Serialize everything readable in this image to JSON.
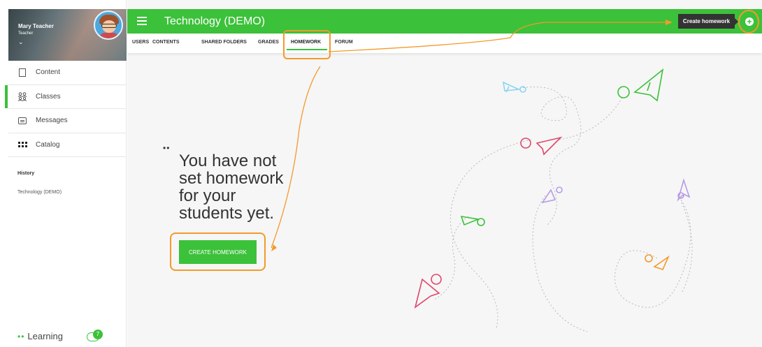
{
  "sidebar": {
    "profile": {
      "name": "Mary Teacher",
      "role": "Teacher",
      "chevron": "⌄"
    },
    "items": [
      {
        "label": "Content",
        "icon": "content-icon",
        "active": false
      },
      {
        "label": "Classes",
        "icon": "classes-icon",
        "active": true
      },
      {
        "label": "Messages",
        "icon": "messages-icon",
        "active": false
      },
      {
        "label": "Catalog",
        "icon": "catalog-icon",
        "active": false
      }
    ],
    "history_title": "History",
    "history_items": [
      "Technology (DEMO)"
    ],
    "footer": {
      "brand": "Learning",
      "dots": "••",
      "chat_badge": "7"
    }
  },
  "header": {
    "title": "Technology (DEMO)",
    "create_button": "Create homework",
    "plus": "+"
  },
  "tabs": [
    {
      "label": "USERS"
    },
    {
      "label": "CONTENTS"
    },
    {
      "label": "SHARED FOLDERS"
    },
    {
      "label": "GRADES"
    },
    {
      "label": "HOMEWORK",
      "active": true
    },
    {
      "label": "FORUM"
    }
  ],
  "empty_state": {
    "dots": "••",
    "message": "You have not set homework for your students yet.",
    "button": "CREATE HOMEWORK"
  },
  "colors": {
    "brand_green": "#3cc13a",
    "highlight_orange": "#f39a2b",
    "dark_button": "#333333"
  }
}
